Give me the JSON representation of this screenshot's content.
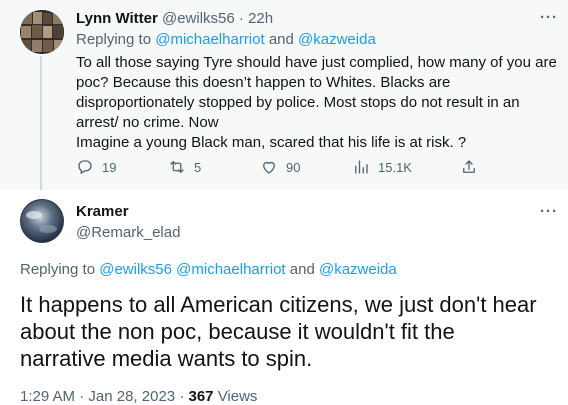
{
  "parent_tweet": {
    "author_name": "Lynn Witter",
    "handle": "@ewilks56",
    "separator": "·",
    "time": "22h",
    "replying_prefix": "Replying to",
    "replying_handle_1": "@michaelharriot",
    "replying_and": "and",
    "replying_handle_2": "@kazweida",
    "text_lines": [
      "To all those saying Tyre should have just complied, how many of you are",
      "poc? Because this doesn’t happen to Whites. Blacks are",
      "disproportionately stopped by police. Most stops do not result in an",
      "arrest/ no crime. Now",
      "Imagine a young Black man, scared that his life is at risk. ?"
    ],
    "more_icon": "more-horizontal-icon",
    "actions": {
      "reply_count": "19",
      "retweet_count": "5",
      "like_count": "90",
      "views_count": "15.1K",
      "reply_icon": "reply-icon",
      "retweet_icon": "retweet-icon",
      "like_icon": "heart-icon",
      "views_icon": "analytics-icon",
      "share_icon": "share-icon"
    }
  },
  "main_tweet": {
    "author_name": "Kramer",
    "handle": "@Remark_elad",
    "replying_prefix": "Replying to",
    "replying_handle_1": "@ewilks56",
    "replying_handle_2": "@michaelharriot",
    "replying_and": "and",
    "replying_handle_3": "@kazweida",
    "text_lines": [
      "It happens to all American citizens, we just don't hear",
      "about the non poc, because it wouldn't fit the",
      "narrative media wants to spin."
    ],
    "time": "1:29 AM",
    "date_separator": "·",
    "date": "Jan 28, 2023",
    "views_separator": "·",
    "views_count": "367",
    "views_label": "Views",
    "more_icon": "more-horizontal-icon"
  },
  "colors": {
    "link": "#1d9bf0",
    "secondary_text": "#536471",
    "primary_text": "#0f1419",
    "parent_background": "#f7f9f9"
  }
}
